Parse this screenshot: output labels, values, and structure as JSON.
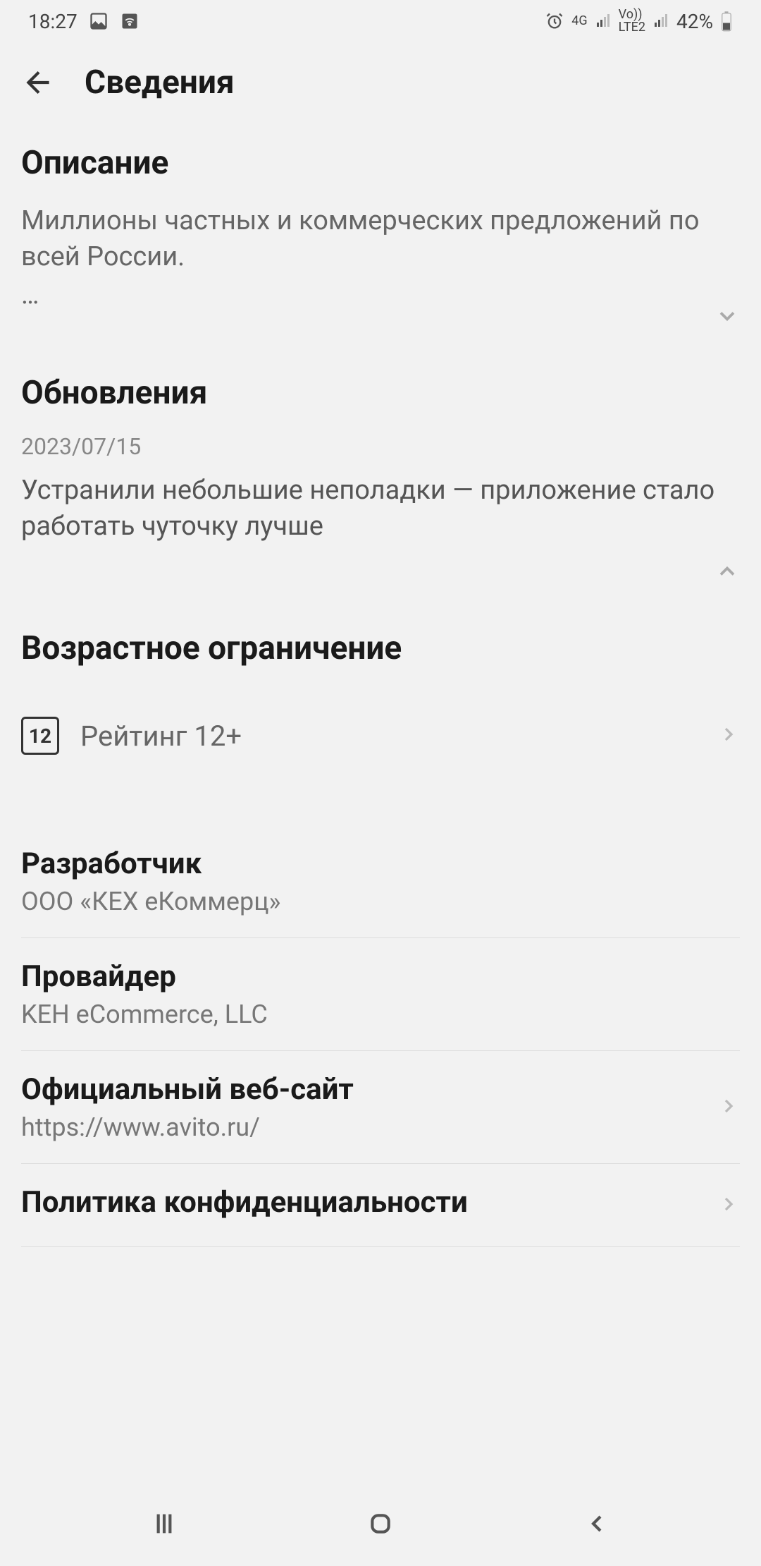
{
  "status_bar": {
    "time": "18:27",
    "battery": "42%",
    "net1": "4G",
    "net2": "LTE2",
    "vo": "Vo))"
  },
  "header": {
    "title": "Сведения"
  },
  "description": {
    "title": "Описание",
    "text": "Миллионы частных и коммерческих предложений по всей России.",
    "ellipsis": "…"
  },
  "updates": {
    "title": "Обновления",
    "date": "2023/07/15",
    "text": "Устранили небольшие неполадки — приложение стало работать чуточку лучше"
  },
  "age": {
    "title": "Возрастное ограничение",
    "badge": "12",
    "label": "Рейтинг 12+"
  },
  "info": {
    "developer": {
      "label": "Разработчик",
      "value": "ООО «КЕХ еКоммерц»"
    },
    "provider": {
      "label": "Провайдер",
      "value": "KEH eCommerce, LLC"
    },
    "website": {
      "label": "Официальный веб-сайт",
      "value": "https://www.avito.ru/"
    },
    "privacy": {
      "label": "Политика конфиденциальности"
    }
  }
}
